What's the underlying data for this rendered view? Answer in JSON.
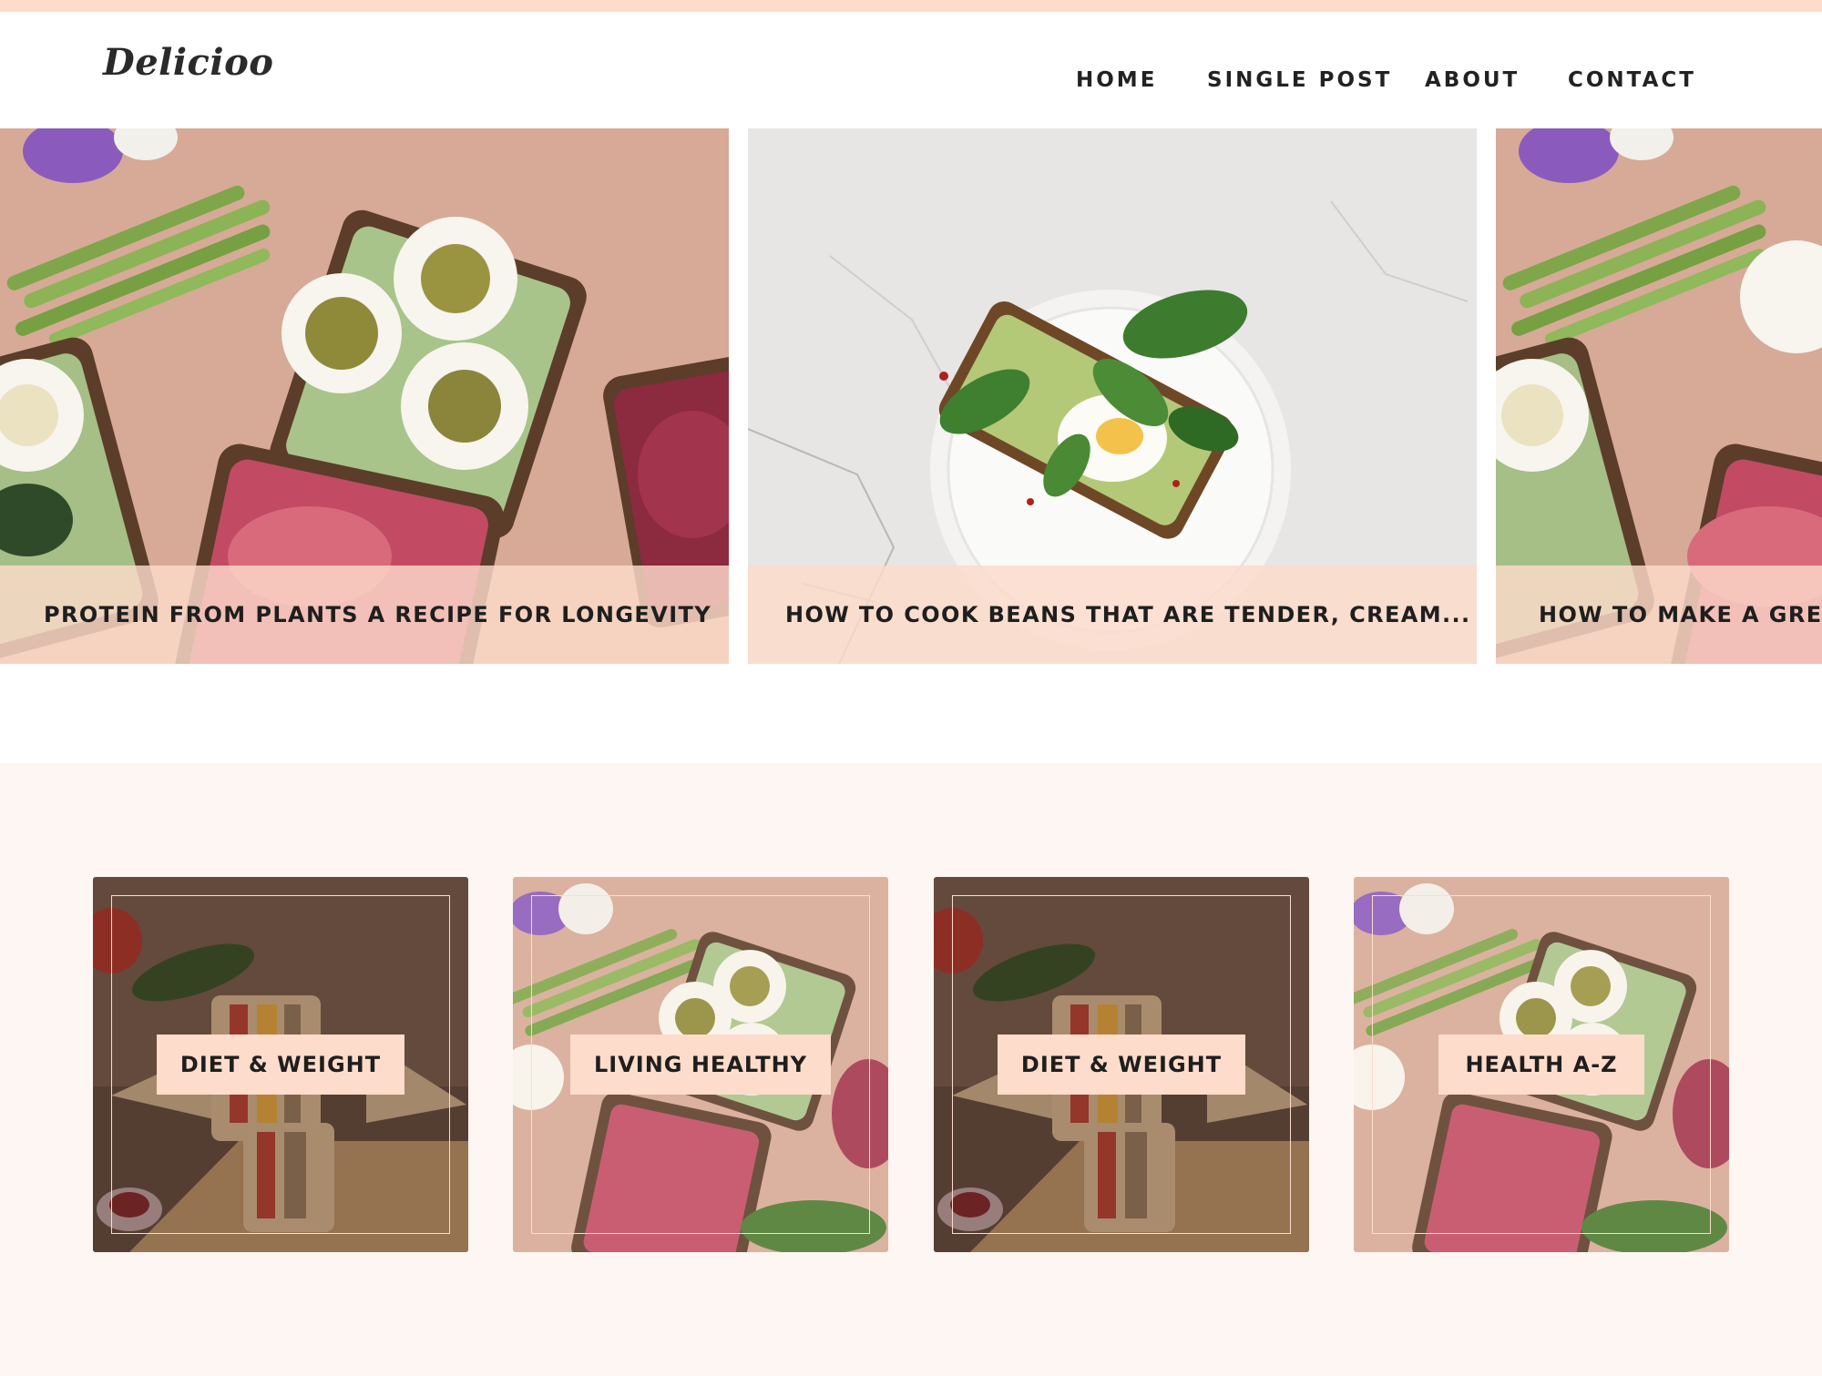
{
  "site": {
    "logo": "Delicioo"
  },
  "nav": {
    "items": [
      "HOME",
      "SINGLE POST",
      "ABOUT",
      "CONTACT"
    ]
  },
  "slider": {
    "slides": [
      {
        "title": "PROTEIN FROM PLANTS A RECIPE FOR LONGEVITY"
      },
      {
        "title": "HOW TO COOK BEANS THAT ARE TENDER, CREAM..."
      },
      {
        "title": "HOW TO MAKE A GREA"
      }
    ]
  },
  "categories": {
    "items": [
      {
        "label": "DIET & WEIGHT"
      },
      {
        "label": "LIVING HEALTHY"
      },
      {
        "label": "DIET & WEIGHT"
      },
      {
        "label": "HEALTH A-Z"
      }
    ]
  },
  "colors": {
    "accent": "#fddccb",
    "section_bg": "#fdf6f2",
    "text": "#1e1e1e"
  }
}
